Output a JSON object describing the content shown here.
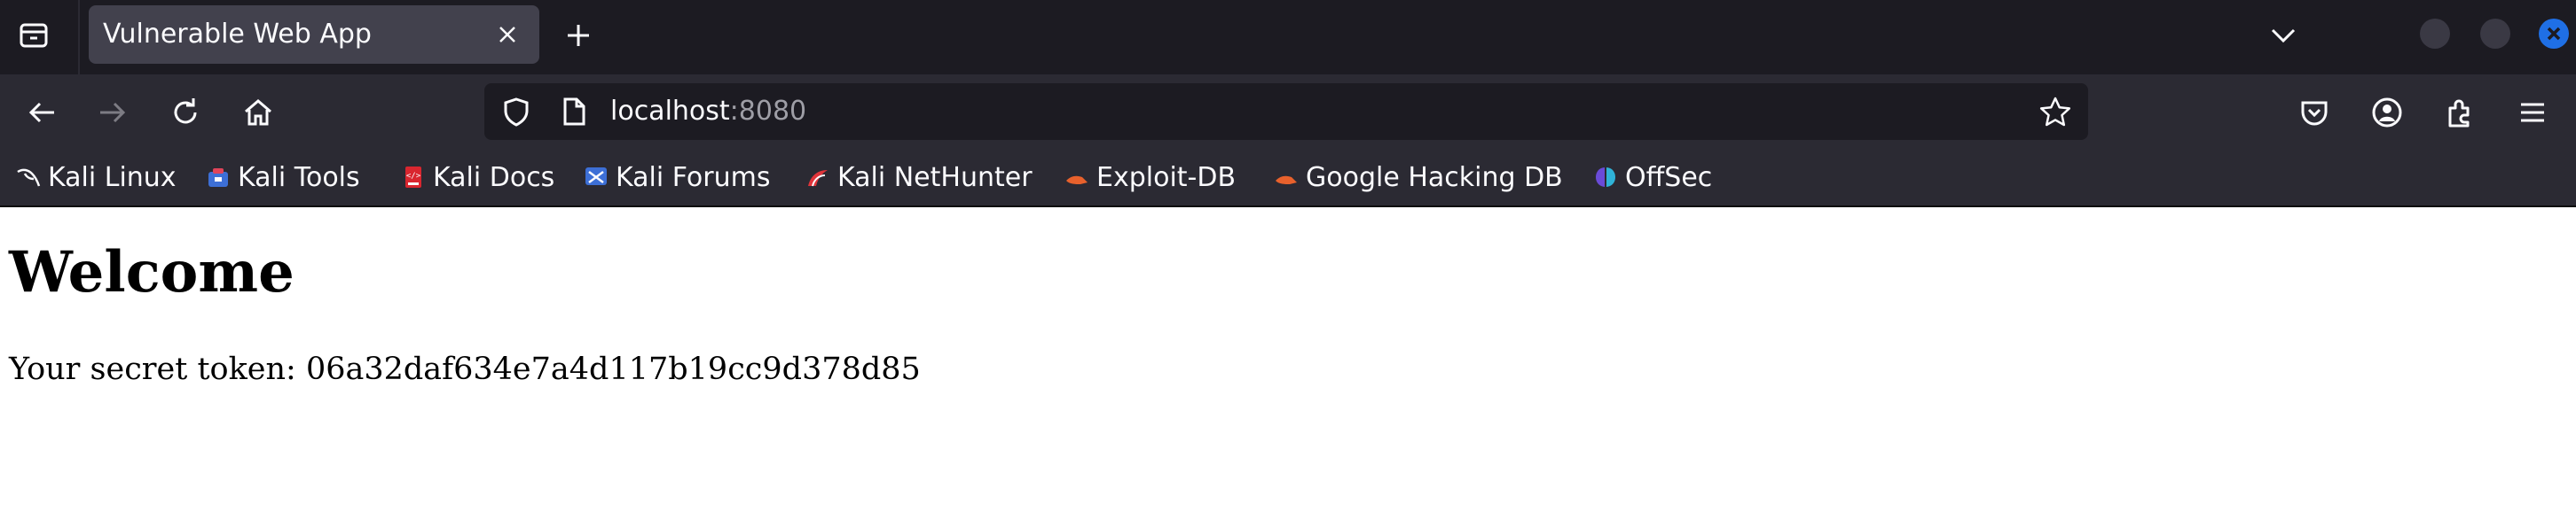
{
  "tab": {
    "title": "Vulnerable Web App"
  },
  "url": {
    "host": "localhost",
    "port": ":8080"
  },
  "bookmarks": [
    {
      "label": "Kali Linux",
      "icon": "kali-dragon-icon"
    },
    {
      "label": "Kali Tools",
      "icon": "kali-tools-icon"
    },
    {
      "label": "Kali Docs",
      "icon": "kali-docs-icon"
    },
    {
      "label": "Kali Forums",
      "icon": "kali-forums-icon"
    },
    {
      "label": "Kali NetHunter",
      "icon": "kali-nethunter-icon"
    },
    {
      "label": "Exploit-DB",
      "icon": "exploit-db-icon"
    },
    {
      "label": "Google Hacking DB",
      "icon": "ghdb-icon"
    },
    {
      "label": "OffSec",
      "icon": "offsec-icon"
    }
  ],
  "page": {
    "heading": "Welcome",
    "token_text": "Your secret token: 06a32daf634e7a4d117b19cc9d378d85"
  },
  "colors": {
    "tabbar_bg": "#1c1b22",
    "toolbar_bg": "#2b2a33",
    "active_tab_bg": "#42414d",
    "close_button": "#1f6fe5"
  }
}
